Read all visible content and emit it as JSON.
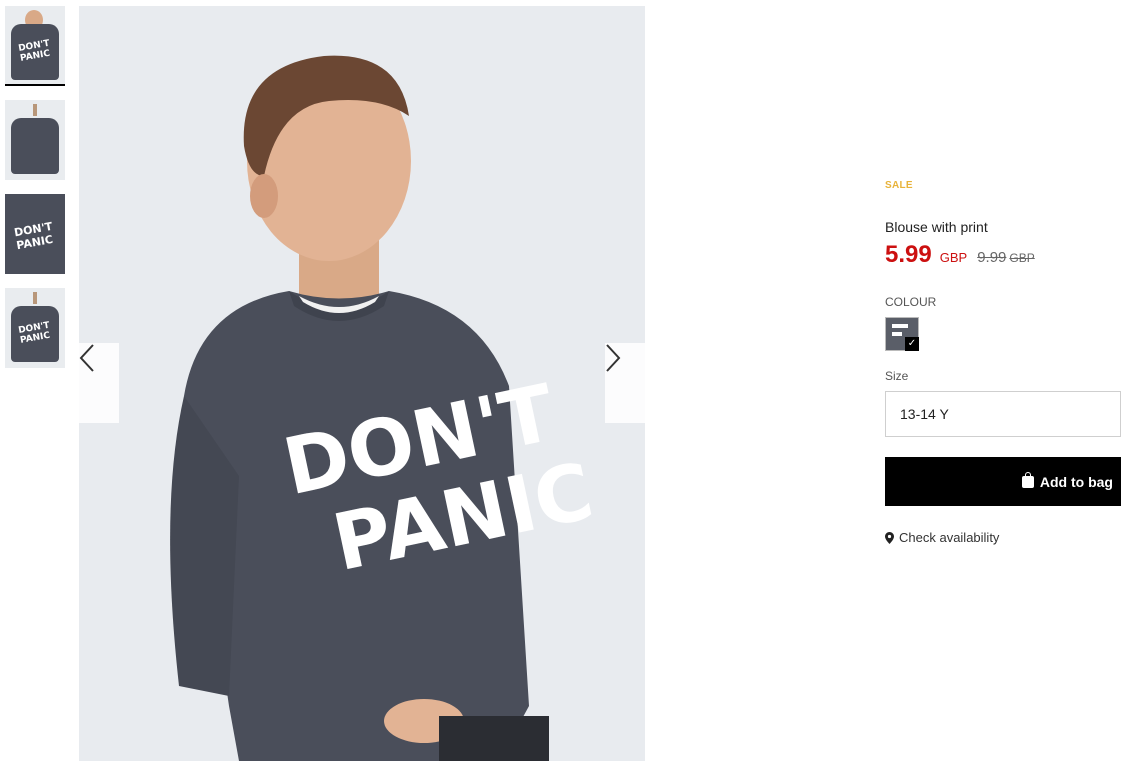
{
  "gallery": {
    "thumbnails": [
      {
        "name": "model-front",
        "text": "DON'T PANIC"
      },
      {
        "name": "hanger-back",
        "text": ""
      },
      {
        "name": "closeup-print",
        "text": "DON'T PANIC"
      },
      {
        "name": "hanger-front",
        "text": "DON'T PANIC"
      }
    ],
    "main_image_text_line1": "DON'T",
    "main_image_text_line2": "PANIC",
    "prev_icon": "chevron-left-icon",
    "next_icon": "chevron-right-icon"
  },
  "product": {
    "badge": "SALE",
    "title": "Blouse with print",
    "price": "5.99",
    "currency": "GBP",
    "old_price": "9.99",
    "old_currency": "GBP",
    "colour_label": "COLOUR",
    "size_label": "Size",
    "selected_size": "13-14 Y",
    "add_to_bag_label": "Add to bag",
    "check_availability_label": "Check availability"
  },
  "colors": {
    "sale_badge": "#e8b33a",
    "price": "#cc1010",
    "button_bg": "#000000",
    "sweater": "#4a4e5a"
  }
}
